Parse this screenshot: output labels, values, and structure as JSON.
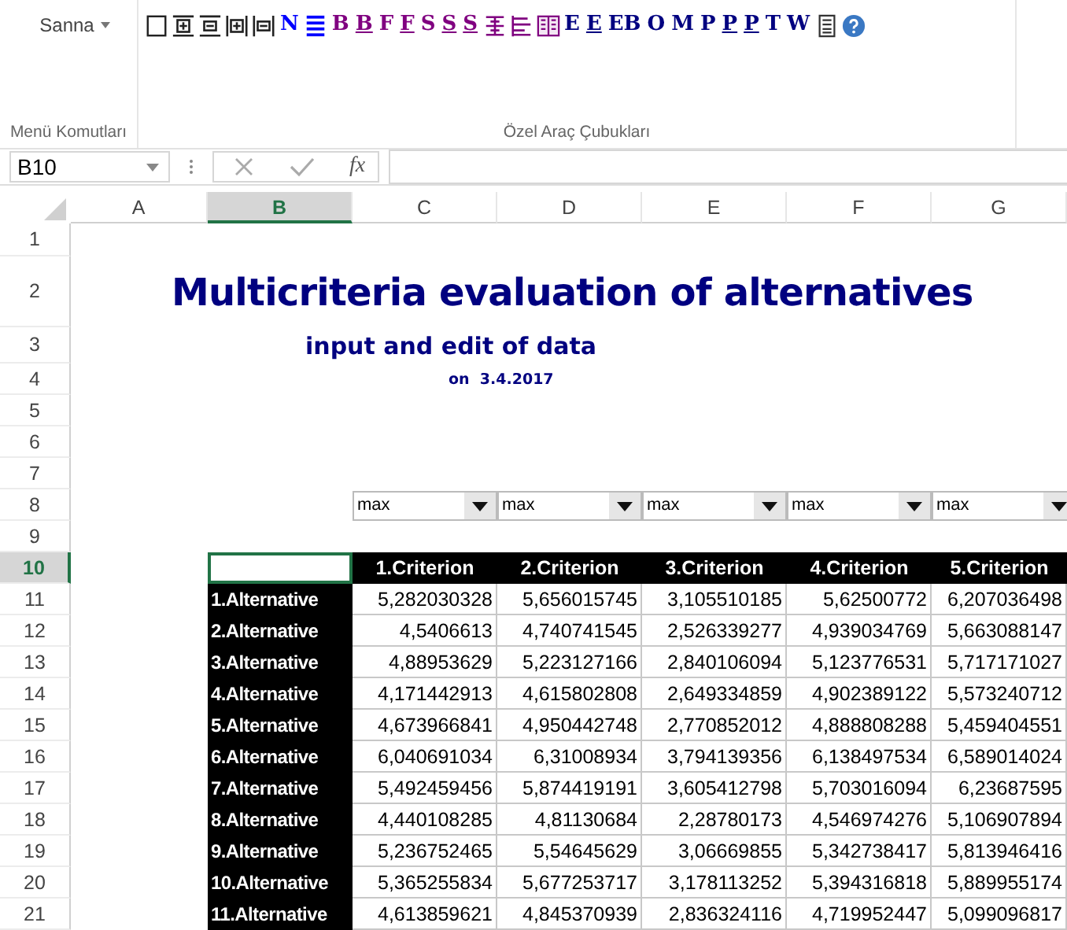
{
  "ribbon": {
    "dropdown": "Sanna",
    "tools": [
      {
        "kind": "box",
        "color": "#222222"
      },
      {
        "kind": "box-plus",
        "color": "#222222"
      },
      {
        "kind": "box-minus",
        "color": "#222222"
      },
      {
        "kind": "col-plus",
        "color": "#222222"
      },
      {
        "kind": "col-minus",
        "color": "#222222"
      },
      {
        "kind": "letter",
        "label": "N",
        "underlined": false,
        "color": "#0000ff"
      },
      {
        "kind": "list",
        "color": "#0000ff"
      },
      {
        "kind": "letter",
        "label": "B",
        "underlined": false,
        "color": "#800080"
      },
      {
        "kind": "letter",
        "label": "B",
        "underlined": true,
        "color": "#800080"
      },
      {
        "kind": "letter",
        "label": "F",
        "underlined": false,
        "color": "#800080"
      },
      {
        "kind": "letter",
        "label": "F",
        "underlined": true,
        "color": "#800080"
      },
      {
        "kind": "letter",
        "label": "S",
        "underlined": false,
        "color": "#800080"
      },
      {
        "kind": "letter",
        "label": "S",
        "underlined": true,
        "color": "#800080"
      },
      {
        "kind": "letter",
        "label": "S",
        "underlined": true,
        "color": "#800080"
      },
      {
        "kind": "table",
        "color": "#800080"
      },
      {
        "kind": "indent",
        "color": "#800080"
      },
      {
        "kind": "book",
        "color": "#800080"
      },
      {
        "kind": "letter",
        "label": "E",
        "underlined": false,
        "color": "#000080"
      },
      {
        "kind": "letter",
        "label": "E",
        "underlined": true,
        "color": "#000080"
      },
      {
        "kind": "letter",
        "label": "EB",
        "underlined": false,
        "color": "#000080"
      },
      {
        "kind": "letter",
        "label": "O",
        "underlined": false,
        "color": "#000080"
      },
      {
        "kind": "letter",
        "label": "M",
        "underlined": false,
        "color": "#000080"
      },
      {
        "kind": "letter",
        "label": "P",
        "underlined": false,
        "color": "#000080"
      },
      {
        "kind": "letter",
        "label": "P",
        "underlined": true,
        "color": "#000080"
      },
      {
        "kind": "letter",
        "label": "P",
        "underlined": true,
        "color": "#000080"
      },
      {
        "kind": "letter",
        "label": "T",
        "underlined": false,
        "color": "#000080"
      },
      {
        "kind": "letter",
        "label": "W",
        "underlined": false,
        "color": "#000080"
      },
      {
        "kind": "doc",
        "color": "#333333"
      },
      {
        "kind": "help",
        "color": "#3a78c3"
      }
    ],
    "groups": [
      "Menü Komutları",
      "Özel Araç Çubukları"
    ]
  },
  "formula_bar": {
    "name_box": "B10",
    "fx": "fx"
  },
  "sheet": {
    "columns": [
      {
        "label": "A",
        "selected": false
      },
      {
        "label": "B",
        "selected": true
      },
      {
        "label": "C",
        "selected": false
      },
      {
        "label": "D",
        "selected": false
      },
      {
        "label": "E",
        "selected": false
      },
      {
        "label": "F",
        "selected": false
      },
      {
        "label": "G",
        "selected": false
      }
    ],
    "row_numbers": [
      {
        "label": "1",
        "selected": false
      },
      {
        "label": "2",
        "selected": false
      },
      {
        "label": "3",
        "selected": false
      },
      {
        "label": "4",
        "selected": false
      },
      {
        "label": "5",
        "selected": false
      },
      {
        "label": "6",
        "selected": false
      },
      {
        "label": "7",
        "selected": false
      },
      {
        "label": "8",
        "selected": false
      },
      {
        "label": "9",
        "selected": false
      },
      {
        "label": "10",
        "selected": true
      },
      {
        "label": "11",
        "selected": false
      },
      {
        "label": "12",
        "selected": false
      },
      {
        "label": "13",
        "selected": false
      },
      {
        "label": "14",
        "selected": false
      },
      {
        "label": "15",
        "selected": false
      },
      {
        "label": "16",
        "selected": false
      },
      {
        "label": "17",
        "selected": false
      },
      {
        "label": "18",
        "selected": false
      },
      {
        "label": "19",
        "selected": false
      },
      {
        "label": "20",
        "selected": false
      },
      {
        "label": "21",
        "selected": false
      }
    ],
    "title": "Multicriteria evaluation of alternatives",
    "subtitle": "input and edit of data",
    "date": "on  3.4.2017",
    "directions": [
      "max",
      "max",
      "max",
      "max",
      "max"
    ],
    "table": {
      "columns": [
        "1.Criterion",
        "2.Criterion",
        "3.Criterion",
        "4.Criterion",
        "5.Criterion"
      ],
      "rows": [
        {
          "label": "1.Alternative",
          "values": [
            "5,282030328",
            "5,656015745",
            "3,105510185",
            "5,62500772",
            "6,207036498"
          ]
        },
        {
          "label": "2.Alternative",
          "values": [
            "4,5406613",
            "4,740741545",
            "2,526339277",
            "4,939034769",
            "5,663088147"
          ]
        },
        {
          "label": "3.Alternative",
          "values": [
            "4,88953629",
            "5,223127166",
            "2,840106094",
            "5,123776531",
            "5,717171027"
          ]
        },
        {
          "label": "4.Alternative",
          "values": [
            "4,171442913",
            "4,615802808",
            "2,649334859",
            "4,902389122",
            "5,573240712"
          ]
        },
        {
          "label": "5.Alternative",
          "values": [
            "4,673966841",
            "4,950442748",
            "2,770852012",
            "4,888808288",
            "5,459404551"
          ]
        },
        {
          "label": "6.Alternative",
          "values": [
            "6,040691034",
            "6,31008934",
            "3,794139356",
            "6,138497534",
            "6,589014024"
          ]
        },
        {
          "label": "7.Alternative",
          "values": [
            "5,492459456",
            "5,874419191",
            "3,605412798",
            "5,703016094",
            "6,23687595"
          ]
        },
        {
          "label": "8.Alternative",
          "values": [
            "4,440108285",
            "4,81130684",
            "2,28780173",
            "4,546974276",
            "5,106907894"
          ]
        },
        {
          "label": "9.Alternative",
          "values": [
            "5,236752465",
            "5,54645629",
            "3,06669855",
            "5,342738417",
            "5,813946416"
          ]
        },
        {
          "label": "10.Alternative",
          "values": [
            "5,365255834",
            "5,677253717",
            "3,178113252",
            "5,394316818",
            "5,889955174"
          ]
        },
        {
          "label": "11.Alternative",
          "values": [
            "4,613859621",
            "4,845370939",
            "2,836324116",
            "4,719952447",
            "5,099096817"
          ]
        }
      ]
    }
  }
}
